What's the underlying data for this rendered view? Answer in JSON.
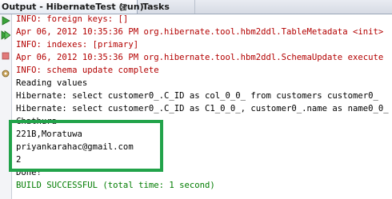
{
  "tabs": [
    {
      "label": "Output - HibernateTest (run)",
      "active": true,
      "close": "⊠"
    },
    {
      "label": "Tasks",
      "active": false
    }
  ],
  "output_lines": [
    {
      "text": "INFO: foreign keys: []",
      "kind": "err"
    },
    {
      "text": "Apr 06, 2012 10:35:36 PM org.hibernate.tool.hbm2ddl.TableMetadata <init>",
      "kind": "err"
    },
    {
      "text": "INFO: indexes: [primary]",
      "kind": "err"
    },
    {
      "text": "Apr 06, 2012 10:35:36 PM org.hibernate.tool.hbm2ddl.SchemaUpdate execute",
      "kind": "err"
    },
    {
      "text": "INFO: schema update complete",
      "kind": "err"
    },
    {
      "text": "Reading values",
      "kind": "norm"
    },
    {
      "text": "Hibernate: select customer0_.C_ID as col_0_0_ from customers customer0_",
      "kind": "norm"
    },
    {
      "text": "Hibernate: select customer0_.C_ID as C1_0_0_, customer0_.name as name0_0_",
      "kind": "norm"
    },
    {
      "text": "Chathura",
      "kind": "norm"
    },
    {
      "text": "221B,Moratuwa",
      "kind": "norm"
    },
    {
      "text": "priyankarahac@gmail.com",
      "kind": "norm"
    },
    {
      "text": "2",
      "kind": "norm"
    },
    {
      "text": "Done!",
      "kind": "norm"
    },
    {
      "text": "BUILD SUCCESSFUL (total time: 1 second)",
      "kind": "ok"
    }
  ],
  "colors": {
    "error_text": "#b30000",
    "normal_text": "#000000",
    "success_text": "#007c00",
    "highlight_border": "#22a34a"
  },
  "toolbar_icons": [
    "rerun-icon",
    "rerun-with-options-icon",
    "stop-icon",
    "settings-icon"
  ]
}
